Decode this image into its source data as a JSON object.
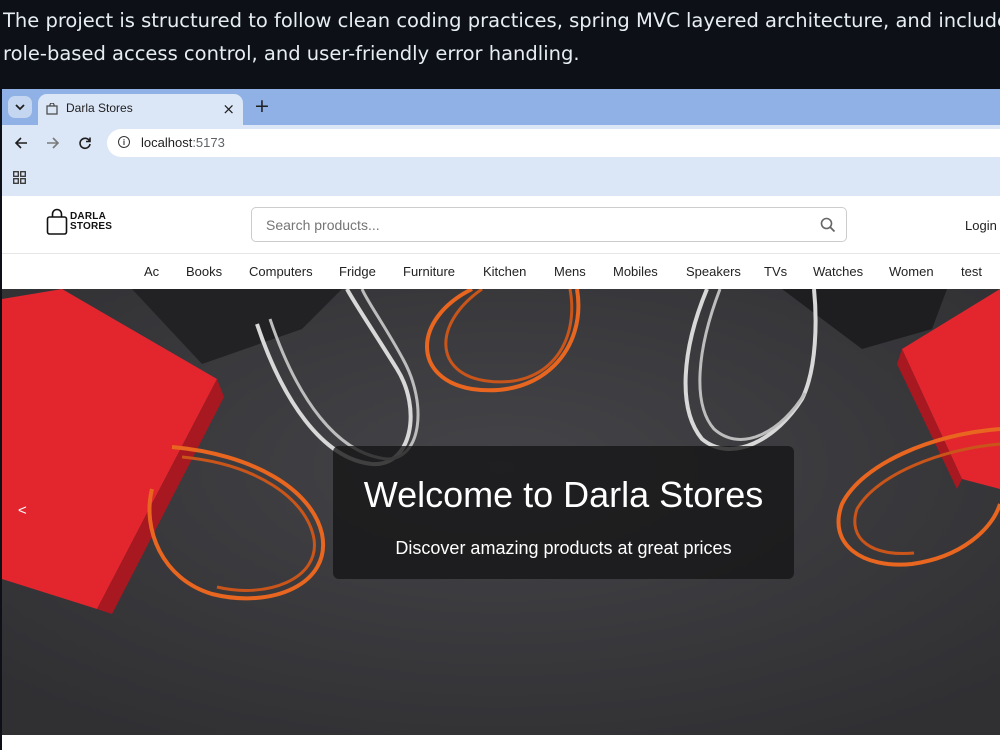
{
  "intro": {
    "line1": "The project is structured to follow clean coding practices, spring MVC layered architecture, and include",
    "line2": "role-based access control, and user-friendly error handling."
  },
  "browser": {
    "tab_title": "Darla Stores",
    "tab_close": "×",
    "new_tab": "+",
    "url_host": "localhost",
    "url_port": ":5173"
  },
  "site": {
    "logo_line1": "DARLA",
    "logo_line2": "STORES",
    "search_placeholder": "Search products...",
    "login": "Login",
    "categories": [
      "Ac",
      "Books",
      "Computers",
      "Fridge",
      "Furniture",
      "Kitchen",
      "Mens",
      "Mobiles",
      "Speakers",
      "TVs",
      "Watches",
      "Women",
      "test"
    ],
    "hero": {
      "title": "Welcome to Darla Stores",
      "subtitle": "Discover amazing products at great prices",
      "prev": "<"
    }
  },
  "colors": {
    "page_bg": "#0d1117",
    "tabbar": "#8fb1e6",
    "toolbar": "#dbe6f7",
    "hero_bg": "#3a3a3d",
    "bag_red": "#e8262f",
    "cord_orange": "#e8661f"
  },
  "icons": [
    "chevron-down-icon",
    "favicon-icon",
    "close-icon",
    "plus-icon",
    "back-arrow-icon",
    "forward-arrow-icon",
    "reload-icon",
    "info-icon",
    "apps-grid-icon",
    "shopping-bag-icon",
    "search-icon"
  ]
}
